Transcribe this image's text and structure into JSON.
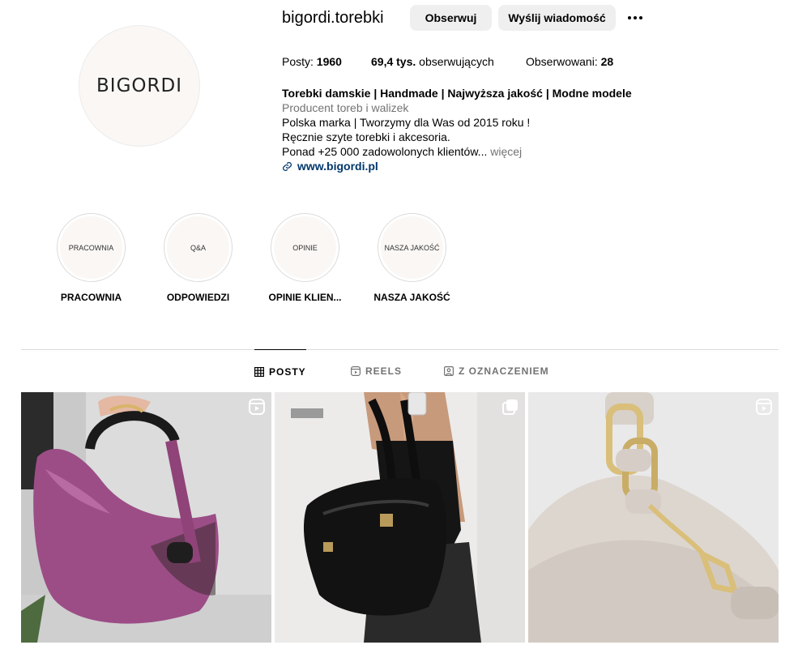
{
  "profile": {
    "username": "bigordi.torebki",
    "avatar_text": "BIGORDI",
    "follow_label": "Obserwuj",
    "message_label": "Wyślij wiadomość",
    "more_icon": "more-horizontal-icon"
  },
  "stats": {
    "posts_label": "Posty:",
    "posts_value": "1960",
    "followers_value": "69,4 tys.",
    "followers_label": "obserwujących",
    "following_label": "Obserwowani:",
    "following_value": "28"
  },
  "bio": {
    "name": "Torebki damskie | Handmade | Najwyższa jakość | Modne modele",
    "category": "Producent toreb i walizek",
    "line1": "Polska marka | Tworzymy dla Was od 2015 roku !",
    "line2": "Ręcznie szyte torebki i akcesoria.",
    "line3": "Ponad +25 000 zadowolonych klientów...",
    "more": "więcej",
    "link": "www.bigordi.pl",
    "link_icon": "link-icon"
  },
  "highlights": [
    {
      "cover_text": "PRACOWNIA",
      "label": "PRACOWNIA"
    },
    {
      "cover_text": "Q&A",
      "label": "ODPOWIEDZI"
    },
    {
      "cover_text": "OPINIE",
      "label": "OPINIE KLIEN..."
    },
    {
      "cover_text": "NASZA JAKOŚĆ",
      "label": "NASZA JAKOŚĆ"
    }
  ],
  "tabs": [
    {
      "label": "POSTY",
      "icon": "grid-icon",
      "active": true
    },
    {
      "label": "REELS",
      "icon": "reels-icon",
      "active": false
    },
    {
      "label": "Z OZNACZENIEM",
      "icon": "tagged-icon",
      "active": false
    }
  ],
  "posts": [
    {
      "type": "reel",
      "badge_icon": "reel-icon",
      "subject": "purple-handbag"
    },
    {
      "type": "carousel",
      "badge_icon": "carousel-icon",
      "subject": "black-shoulder-bag"
    },
    {
      "type": "reel",
      "badge_icon": "reel-icon",
      "subject": "beige-bag-gold-chain"
    }
  ],
  "colors": {
    "button_bg": "#efefef",
    "link": "#00376b",
    "secondary_text": "#737373",
    "divider": "#dbdbdb"
  }
}
